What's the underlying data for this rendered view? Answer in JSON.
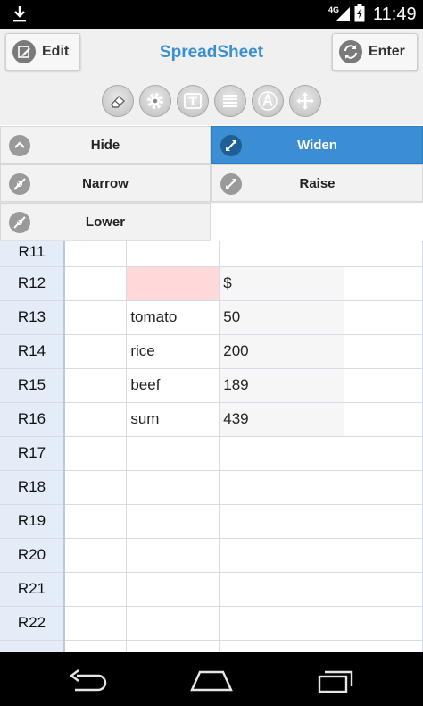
{
  "status_bar": {
    "time": "11:49",
    "network": "4G"
  },
  "header": {
    "title": "SpreadSheet",
    "edit_label": "Edit",
    "enter_label": "Enter",
    "tools": [
      "eraser-icon",
      "gear-icon",
      "text-box-icon",
      "lines-icon",
      "font-icon",
      "move-icon"
    ]
  },
  "menu": {
    "hide": "Hide",
    "widen": "Widen",
    "narrow": "Narrow",
    "raise": "Raise",
    "lower": "Lower",
    "active": "widen",
    "active_color": "#3b8ed3"
  },
  "grid": {
    "rows": [
      {
        "label": "R11",
        "cells": [
          "",
          "",
          "",
          ""
        ]
      },
      {
        "label": "R12",
        "cells": [
          "",
          "",
          "$",
          ""
        ]
      },
      {
        "label": "R13",
        "cells": [
          "",
          "tomato",
          "50",
          ""
        ]
      },
      {
        "label": "R14",
        "cells": [
          "",
          "rice",
          "200",
          ""
        ]
      },
      {
        "label": "R15",
        "cells": [
          "",
          "beef",
          "189",
          ""
        ]
      },
      {
        "label": "R16",
        "cells": [
          "",
          "sum",
          "439",
          ""
        ]
      },
      {
        "label": "R17",
        "cells": [
          "",
          "",
          "",
          ""
        ]
      },
      {
        "label": "R18",
        "cells": [
          "",
          "",
          "",
          ""
        ]
      },
      {
        "label": "R19",
        "cells": [
          "",
          "",
          "",
          ""
        ]
      },
      {
        "label": "R20",
        "cells": [
          "",
          "",
          "",
          ""
        ]
      },
      {
        "label": "R21",
        "cells": [
          "",
          "",
          "",
          ""
        ]
      },
      {
        "label": "R22",
        "cells": [
          "",
          "",
          "",
          ""
        ]
      },
      {
        "label": "",
        "cells": [
          "",
          "",
          "",
          ""
        ]
      }
    ],
    "highlight_color": "#ffd9d9"
  }
}
